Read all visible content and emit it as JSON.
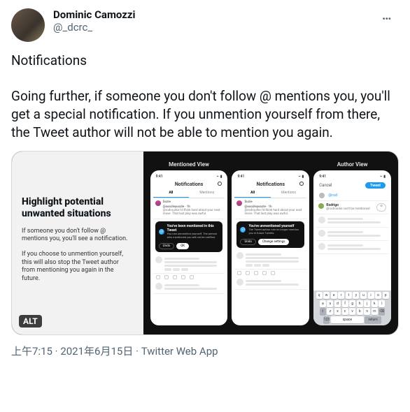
{
  "author": {
    "name": "Dominic Camozzi",
    "handle": "@_dcrc_"
  },
  "more": "…",
  "body_text": "Notifications\n\nGoing further, if someone you don't follow @ mentions you, you'll get a special notification. If you unmention yourself from there, the Tweet author will not be able to mention you again.",
  "alt_badge": "ALT",
  "meta": {
    "time": "上午7:15",
    "date": "2021年6月15日",
    "source": "Twitter Web App"
  },
  "promo": {
    "heading": "Highlight potential unwanted situations",
    "p1": "If someone you don't follow @ mentions you, you'll see a notification.",
    "p2": "If you choose to unmention yourself, this will also stop the Tweet author from mentioning you again in the future."
  },
  "cols": {
    "mentioned": "Mentioned View",
    "author": "Author View"
  },
  "phone": {
    "time": "9:41",
    "signal": "▪▫ ▮",
    "title": "Notifications",
    "tabs": {
      "all": "All",
      "mentions": "Mentions"
    },
    "sample": {
      "name": "Suzie",
      "handle": "@soozleyoozle · 1h",
      "text": "@rodrourke I'd think hard about your next move. That last play was awful."
    },
    "banner1": {
      "title": "You've been mentioned in this Tweet",
      "sub": "You can unmention yourself. The person who mentioned you will not be notified.",
      "undo": "Undo",
      "ok": "OK"
    },
    "banner2": {
      "title": "You've unmentioned yourself",
      "sub": "The Tweet author can no longer mention you in future Tweets.",
      "undo": "Undo",
      "change": "Change settings"
    },
    "compose": {
      "cancel": "Cancel",
      "tweet": "Tweet",
      "mention": "@rod",
      "sugg_name": "Rodrigo",
      "sugg_sub": "@rodrourke can't be mentioned"
    },
    "keys": {
      "r1": [
        "q",
        "w",
        "e",
        "r",
        "t",
        "y",
        "u",
        "i",
        "o",
        "p"
      ],
      "r2": [
        "a",
        "s",
        "d",
        "f",
        "g",
        "h",
        "j",
        "k",
        "l"
      ],
      "r3": [
        "z",
        "x",
        "c",
        "v",
        "b",
        "n",
        "m"
      ],
      "shift": "⇧",
      "del": "⌫",
      "num": "123",
      "space": "space",
      "ret": "return"
    }
  }
}
